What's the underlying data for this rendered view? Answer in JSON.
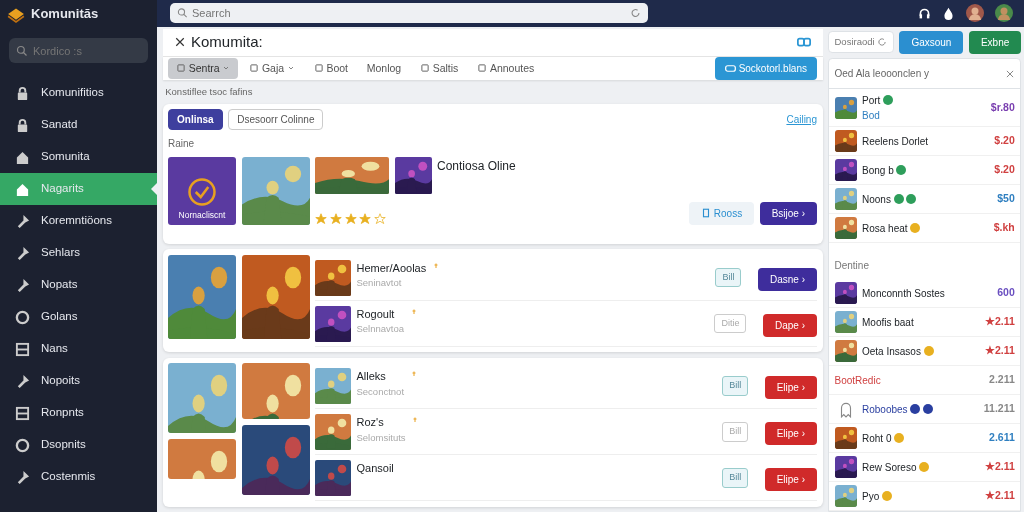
{
  "app": {
    "name": "Komunitās"
  },
  "sidebar": {
    "search": {
      "placeholder": "Kordico :s"
    },
    "items": [
      {
        "label": "Komunifitios",
        "selected": false
      },
      {
        "label": "Sanatd",
        "selected": false
      },
      {
        "label": "Somunita",
        "selected": false
      },
      {
        "label": "Nagarits",
        "selected": true
      },
      {
        "label": "Koremntiöons",
        "selected": false
      },
      {
        "label": "Sehlars",
        "selected": false
      },
      {
        "label": "Nopats",
        "selected": false
      },
      {
        "label": "Golans",
        "selected": false
      },
      {
        "label": "Nans",
        "selected": false
      },
      {
        "label": "Nopoits",
        "selected": false
      },
      {
        "label": "Ronpnts",
        "selected": false
      },
      {
        "label": "Dsopnits",
        "selected": false
      },
      {
        "label": "Costenmis",
        "selected": false
      }
    ]
  },
  "topbar": {
    "search": {
      "placeholder": "Searrch"
    }
  },
  "header": {
    "title": "Komumita:"
  },
  "toolbar": {
    "tabs": [
      {
        "label": "Sentra",
        "selected": true,
        "dropdown": true
      },
      {
        "label": "Gaja",
        "selected": false,
        "dropdown": true
      },
      {
        "label": "Boot",
        "selected": false,
        "dropdown": false
      },
      {
        "label": "Monlog",
        "selected": false,
        "dropdown": false
      },
      {
        "label": "Saltis",
        "selected": false,
        "dropdown": false
      },
      {
        "label": "Annoutes",
        "selected": false,
        "dropdown": false
      }
    ],
    "action": "Sockotorl.blans"
  },
  "caption": "Konstiflee tsoc fafins",
  "featured": {
    "filters": [
      {
        "label": "Onlinsa",
        "selected": true
      },
      {
        "label": "Dsesoorr Colinne",
        "selected": false
      }
    ],
    "link": "Cailing",
    "section": "Raine",
    "tile_label": "Nornacliscnt",
    "title": "Contiosa Oline",
    "stars": 4,
    "secondary": "Rooss",
    "primary": "Bsijoe ›"
  },
  "groups": [
    {
      "rows": [
        {
          "title": "Hemer/Aoolas",
          "subtitle": "Seninavtot",
          "tag": "Bill",
          "button": "Dasne ›",
          "kind": "primary"
        },
        {
          "title": "Rogoult",
          "subtitle": "Selnnavtoa",
          "tag": "Ditie",
          "button": "Dape ›",
          "kind": "danger"
        }
      ]
    },
    {
      "rows": [
        {
          "title": "Alleks",
          "subtitle": "Seconctnot",
          "tag": "Bill",
          "button": "Elipe ›",
          "kind": "danger"
        },
        {
          "title": "Roz's",
          "subtitle": "Selomsituts",
          "tag": "Bill",
          "button": "Elipe ›",
          "kind": "danger"
        },
        {
          "title": "Qansoil",
          "tag": "Bill",
          "button": "Elipe ›",
          "kind": "danger"
        }
      ]
    }
  ],
  "right": {
    "field": {
      "value": "Dosiraodi"
    },
    "buttons": [
      {
        "label": "Gaxsoun",
        "kind": "info"
      },
      {
        "label": "Exbne",
        "kind": "success"
      }
    ],
    "panel": {
      "title": "Oed Ala leooonclen y",
      "items": [
        {
          "name": "Port",
          "sub": "Bod",
          "price": "$r.80",
          "color": "#7a3fb0",
          "badges": [
            {
              "color": "#2e9e5b"
            }
          ]
        },
        {
          "name": "Reelens Dorlet",
          "price": "$.20",
          "color": "#d04040"
        },
        {
          "name": "Bong b",
          "price": "$.20",
          "color": "#d04040",
          "badges": [
            {
              "color": "#2e9e5b"
            }
          ]
        },
        {
          "name": "Noons",
          "price": "$50",
          "color": "#2f7fc0",
          "badges": [
            {
              "color": "#2e9e5b"
            },
            {
              "color": "#2e9e5b"
            }
          ]
        },
        {
          "name": "Rosa heat",
          "price": "$.kh",
          "color": "#d04040",
          "badges": [
            {
              "color": "#e8b020"
            }
          ]
        }
      ],
      "section": "Dentine",
      "items2": [
        {
          "name": "Monconnth Sostes",
          "price": "600",
          "color": "#6a4fc0"
        },
        {
          "name": "Moofis baat",
          "price": "★2.11",
          "color": "#d04040"
        },
        {
          "name": "Oeta Insasos",
          "price": "★2.11",
          "color": "#d04040",
          "badges": [
            {
              "color": "#e8b020"
            }
          ]
        },
        {
          "name": "BootRedic",
          "price": "2.211",
          "color": "#888888",
          "kind": "heading"
        },
        {
          "name": "Roboobes",
          "price": "11.211",
          "color": "#888888",
          "badges": [
            {
              "color": "#2a3fa0"
            },
            {
              "color": "#2a3fa0"
            }
          ],
          "kind": "ghost"
        },
        {
          "name": "Roht 0",
          "price": "2.611",
          "color": "#2f7fc0",
          "badges": [
            {
              "color": "#e8b020"
            }
          ]
        },
        {
          "name": "Rew Soreso",
          "price": "★2.11",
          "color": "#d04040",
          "badges": [
            {
              "color": "#e8b020"
            }
          ]
        },
        {
          "name": "Pyo",
          "price": "★2.11",
          "color": "#d04040",
          "badges": [
            {
              "color": "#e8b020"
            }
          ]
        }
      ]
    }
  }
}
